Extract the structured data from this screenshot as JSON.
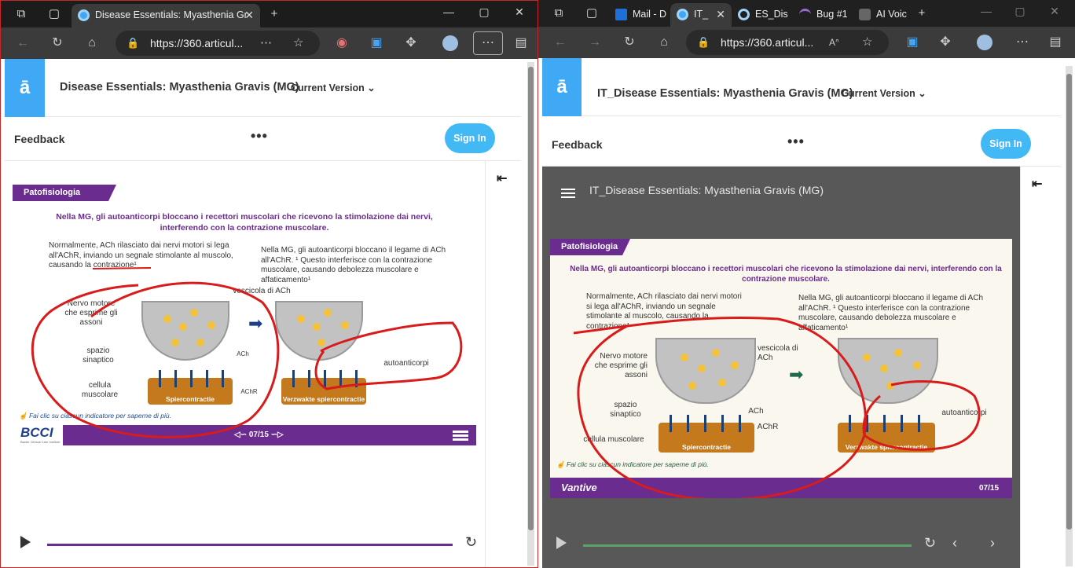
{
  "left": {
    "tab": {
      "title": "Disease Essentials: Myasthenia Gr"
    },
    "address": "https://360.articul...",
    "course_title": "Disease Essentials: Myasthenia Gravis (MG)",
    "version_label": "Current Version",
    "feedback": "Feedback",
    "more": "•••",
    "sign_in": "Sign In",
    "collapse": "⇤",
    "slide": {
      "section": "Patofisiologia",
      "heading": "Nella MG, gli autoanticorpi bloccano i recettori muscolari che ricevono la stimolazione dai nervi, interferendo con la contrazione muscolare.",
      "normal_text": "Normalmente, ACh rilasciato dai nervi motori si lega all'AChR, inviando un segnale stimolante al muscolo, causando la contrazione¹",
      "mg_text": "Nella MG, gli autoanticorpi bloccano il legame di ACh all'AChR. ¹ Questo interferisce con la contrazione muscolare, causando debolezza muscolare e affaticamento¹",
      "label_nerve": "Nervo motore che esprime gli assoni",
      "label_vesicle": "vescicola di ACh",
      "label_space": "spazio sinaptico",
      "label_cell": "cellula muscolare",
      "label_ach": "ACh",
      "label_achr": "AChR",
      "label_autoab": "autoanticorpi",
      "muscle_left": "Spiercontractie",
      "muscle_right": "Verzwakte spiercontractie",
      "hint": "Fai clic su ciascun indicatore per saperne di più.",
      "brand": "BCCI",
      "brand_sub": "Baxter Clinical Care Institute",
      "page": "07/15"
    }
  },
  "right": {
    "tabs": [
      "Mail - D",
      "IT_",
      "ES_Dis",
      "Bug #1",
      "AI Voic"
    ],
    "address": "https://360.articul...",
    "course_title": "IT_Disease Essentials: Myasthenia Gravis (MG)",
    "version_label": "Current Version",
    "feedback": "Feedback",
    "more": "•••",
    "sign_in": "Sign In",
    "collapse": "⇤",
    "player_title": "IT_Disease Essentials: Myasthenia Gravis (MG)",
    "slide": {
      "section": "Patofisiologia",
      "heading": "Nella MG, gli autoanticorpi bloccano i recettori muscolari che ricevono la stimolazione dai nervi, interferendo con la contrazione muscolare.",
      "normal_text": "Normalmente, ACh rilasciato dai nervi motori si lega all'AChR, inviando un segnale stimolante al muscolo, causando la contrazione¹",
      "mg_text": "Nella MG, gli autoanticorpi bloccano il legame di ACh all'AChR. ¹ Questo interferisce con la contrazione muscolare, causando debolezza muscolare e affaticamento¹",
      "label_nerve": "Nervo motore che esprime gli assoni",
      "label_vesicle": "vescicola di ACh",
      "label_space": "spazio sinaptico",
      "label_cell": "cellula muscolare",
      "label_ach": "ACh",
      "label_achr": "AChR",
      "label_autoab": "autoanticorpi",
      "muscle_left": "Spiercontractie",
      "muscle_right": "Verzwakte spiercontractie",
      "hint": "Fai clic su ciascun indicatore per saperne di più.",
      "brand": "Vantive",
      "page": "07/15"
    }
  },
  "colors": {
    "accent": "#42b8f5",
    "brand_purple": "#6a2c8e",
    "ink": "#d81b1b",
    "progress_left": "#6a2c8e",
    "progress_right": "#5aa469"
  }
}
